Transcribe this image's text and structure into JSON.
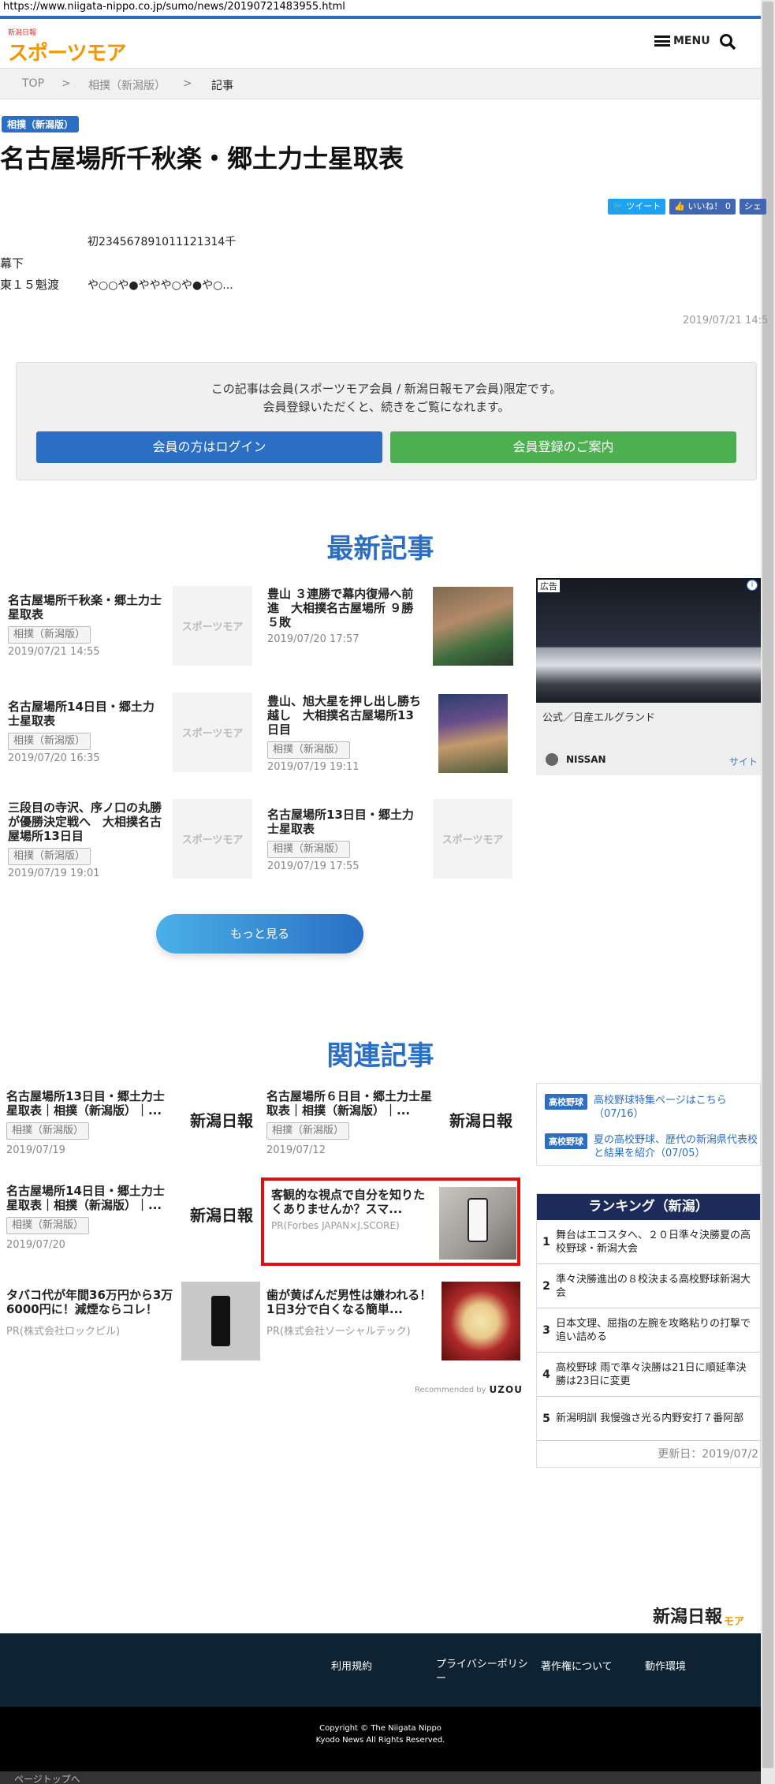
{
  "url": "https://www.niigata-nippo.co.jp/sumo/news/20190721483955.html",
  "header": {
    "logo_small": "新潟日報",
    "logo_main": "スポーツモア",
    "menu_label": "MENU"
  },
  "breadcrumb": {
    "items": [
      "TOP",
      "相撲（新潟版）",
      "記事"
    ],
    "sep": ">"
  },
  "article": {
    "category": "相撲（新潟版）",
    "title": "名古屋場所千秋楽・郷土力士星取表",
    "social": {
      "tweet": "ツイート",
      "like": "いいね！ 0",
      "share": "シェ"
    },
    "table_header": "初234567891011121314千",
    "row1_label": "幕下",
    "row2_label": "東１５魁渡",
    "row2_value": "や○○や●ややや○や●や○...",
    "date": "2019/07/21 14:5"
  },
  "member": {
    "line1": "この記事は会員(スポーツモア会員 / 新潟日報モア会員)限定です。",
    "line2": "会員登録いただくと、続きをご覧になれます。",
    "login_btn": "会員の方はログイン",
    "register_btn": "会員登録のご案内"
  },
  "latest": {
    "heading": "最新記事",
    "items": [
      {
        "title": "名古屋場所千秋楽・郷土力士星取表",
        "tag": "相撲（新潟版）",
        "date": "2019/07/21 14:55",
        "thumb": "スポーツモア"
      },
      {
        "title": "豊山 ３連勝で幕内復帰へ前進　大相撲名古屋場所 ９勝５敗",
        "tag": "",
        "date": "2019/07/20 17:57",
        "thumb": ""
      },
      {
        "title": "名古屋場所14日目・郷土力士星取表",
        "tag": "相撲（新潟版）",
        "date": "2019/07/20 16:35",
        "thumb": "スポーツモア"
      },
      {
        "title": "豊山、旭大星を押し出し勝ち越し　大相撲名古屋場所13日目",
        "tag": "相撲（新潟版）",
        "date": "2019/07/19 19:11",
        "thumb": ""
      },
      {
        "title": "三段目の寺沢、序ノ口の丸勝が優勝決定戦へ　大相撲名古屋場所13日目",
        "tag": "相撲（新潟版）",
        "date": "2019/07/19 19:01",
        "thumb": "スポーツモア"
      },
      {
        "title": "名古屋場所13日目・郷土力士星取表",
        "tag": "相撲（新潟版）",
        "date": "2019/07/19 17:55",
        "thumb": "スポーツモア"
      }
    ],
    "more_btn": "もっと見る"
  },
  "ad": {
    "label": "広告",
    "caption": "公式／日産エルグランド",
    "brand": "NISSAN",
    "site_link": "サイト"
  },
  "related": {
    "heading": "関連記事",
    "items": [
      {
        "title": "名古屋場所13日目・郷土力士星取表｜相撲（新潟版）｜...",
        "tag": "相撲（新潟版）",
        "date": "2019/07/19",
        "thumb": "新潟日報"
      },
      {
        "title": "名古屋場所６日目・郷土力士星取表｜相撲（新潟版）｜...",
        "tag": "相撲（新潟版）",
        "date": "2019/07/12",
        "thumb": "新潟日報"
      },
      {
        "title": "名古屋場所14日目・郷土力士星取表｜相撲（新潟版）｜...",
        "tag": "相撲（新潟版）",
        "date": "2019/07/20",
        "thumb": "新潟日報"
      },
      {
        "title": "客観的な視点で自分を知りたくありませんか？スマ...",
        "tag": "PR(Forbes JAPAN×J.SCORE)",
        "date": "",
        "thumb": ""
      },
      {
        "title": "タバコ代が年間36万円から3万6000円に！減煙ならコレ！",
        "tag": "PR(株式会社ロックピル)",
        "date": "",
        "thumb": ""
      },
      {
        "title": "歯が黄ばんだ男性は嫌われる！1日3分で白くなる簡単...",
        "tag": "PR(株式会社ソーシャルテック)",
        "date": "",
        "thumb": ""
      }
    ],
    "recommended": "Recommended by",
    "uzou": "UZOU"
  },
  "sidebar": {
    "hs": [
      {
        "badge": "高校野球",
        "text": "高校野球特集ページはこちら（07/16）"
      },
      {
        "badge": "高校野球",
        "text": "夏の高校野球、歴代の新潟県代表校と結果を紹介（07/05）"
      }
    ],
    "ranking_title": "ランキング（新潟）",
    "ranking": [
      {
        "num": "1",
        "text": "舞台はエコスタへ、２０日準々決勝夏の高校野球・新潟大会"
      },
      {
        "num": "2",
        "text": "準々決勝進出の８校決まる高校野球新潟大会"
      },
      {
        "num": "3",
        "text": "日本文理、屈指の左腕を攻略粘りの打撃で追い詰める"
      },
      {
        "num": "4",
        "text": "高校野球 雨で準々決勝は21日に順延準決勝は23日に変更"
      },
      {
        "num": "5",
        "text": "新潟明訓 我慢強さ光る内野安打７番阿部"
      }
    ],
    "updated": "更新日：2019/07/2"
  },
  "footer": {
    "logo": "新潟日報",
    "logo_suffix": "モア",
    "links": [
      "利用規約",
      "プライバシーポリシー",
      "著作権について",
      "動作環境"
    ],
    "copyright1": "Copyright © The Niigata Nippo",
    "copyright2": "Kyodo News All Rights Reserved.",
    "pagetop": "ページトップへ"
  },
  "colors": {
    "accent": "#2a6fc4",
    "green": "#4caf50",
    "footer_bg": "#0d2233"
  }
}
